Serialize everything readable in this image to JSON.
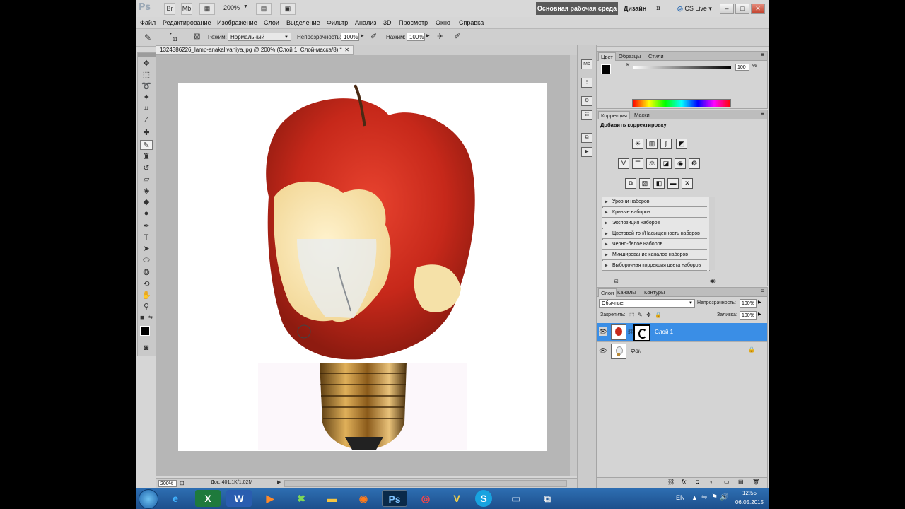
{
  "appbar": {
    "logo": "Ps",
    "zoom": "200%",
    "workspace_active": "Основная рабочая среда",
    "workspace_other": "Дизайн",
    "more": "»",
    "cslive": "CS Live",
    "btn_br": "Br",
    "btn_mb": "Mb"
  },
  "menu": [
    "Файл",
    "Редактирование",
    "Изображение",
    "Слои",
    "Выделение",
    "Фильтр",
    "Анализ",
    "3D",
    "Просмотр",
    "Окно",
    "Справка"
  ],
  "options": {
    "brush_size": "11",
    "mode_label": "Режим:",
    "mode_value": "Нормальный",
    "opacity_label": "Непрозрачность:",
    "opacity_value": "100%",
    "pressure_label": "Нажим:",
    "pressure_value": "100%"
  },
  "document": {
    "tab_title": "1324386226_lamp-anakalivaniya.jpg @ 200% (Слой 1, Слой-маска/8) *",
    "status_zoom": "200%",
    "status_doc": "Док: 401,1K/1,02M"
  },
  "color_panel": {
    "tabs": [
      "Цвет",
      "Образцы",
      "Стили"
    ],
    "channel": "K",
    "value": "100",
    "unit": "%"
  },
  "adjust_panel": {
    "tabs": [
      "Коррекция",
      "Маски"
    ],
    "heading": "Добавить корректировку",
    "presets": [
      "Уровни наборов",
      "Кривые наборов",
      "Экспозиция наборов",
      "Цветовой тон/Насыщенность наборов",
      "Черно-белое наборов",
      "Микширование каналов наборов",
      "Выборочная коррекция цвета наборов"
    ]
  },
  "layers_panel": {
    "tabs": [
      "Слои",
      "Каналы",
      "Контуры"
    ],
    "blend_mode": "Обычные",
    "opacity_label": "Непрозрачность:",
    "opacity_value": "100%",
    "lock_label": "Закрепить:",
    "fill_label": "Заливка:",
    "fill_value": "100%",
    "layers": [
      {
        "name": "Слой 1",
        "selected": true
      },
      {
        "name": "Фон",
        "selected": false
      }
    ]
  },
  "taskbar": {
    "lang": "EN",
    "time": "12:55",
    "date": "06.05.2015"
  },
  "colors": {
    "selected_layer": "#3a8ee6",
    "taskbar": "#1d4f8c",
    "workspace_active": "#5a5a5a"
  }
}
